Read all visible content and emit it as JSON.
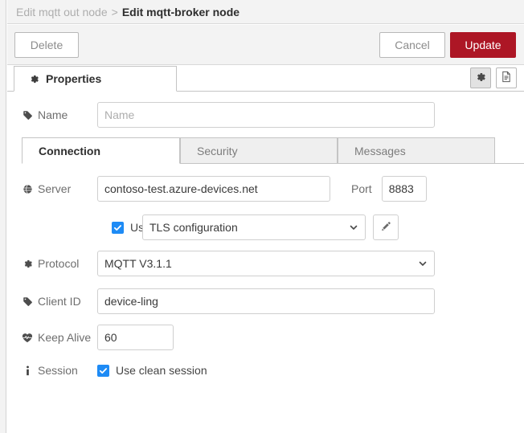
{
  "breadcrumb": {
    "previous": "Edit mqtt out node",
    "separator": ">",
    "current": "Edit mqtt-broker node"
  },
  "actions": {
    "delete_label": "Delete",
    "cancel_label": "Cancel",
    "update_label": "Update",
    "update_color": "#ad1625"
  },
  "outer_tabs": {
    "properties_label": "Properties",
    "gear_icon": "gear-icon",
    "info_button_icon": "document-icon",
    "settings_button_icon": "gear-icon"
  },
  "form": {
    "name": {
      "label": "Name",
      "icon": "tag-icon",
      "value": "",
      "placeholder": "Name"
    },
    "server": {
      "label": "Server",
      "icon": "globe-icon",
      "value": "contoso-test.azure-devices.net",
      "placeholder": ""
    },
    "port": {
      "label": "Port",
      "value": "8883",
      "placeholder": ""
    },
    "tls": {
      "checkbox_label": "Use TLS",
      "checked": true,
      "select_value": "TLS configuration",
      "edit_icon": "pencil-icon"
    },
    "protocol": {
      "label": "Protocol",
      "icon": "gear-icon",
      "value": "MQTT V3.1.1"
    },
    "client_id": {
      "label": "Client ID",
      "icon": "tag-icon",
      "value": "device-ling",
      "placeholder": ""
    },
    "keep_alive": {
      "label": "Keep Alive",
      "icon": "heartbeat-icon",
      "value": "60",
      "placeholder": ""
    },
    "session": {
      "label": "Session",
      "icon": "info-icon",
      "checkbox_label": "Use clean session",
      "checked": true
    }
  },
  "inner_tabs": [
    {
      "label": "Connection",
      "active": true
    },
    {
      "label": "Security",
      "active": false
    },
    {
      "label": "Messages",
      "active": false
    }
  ]
}
